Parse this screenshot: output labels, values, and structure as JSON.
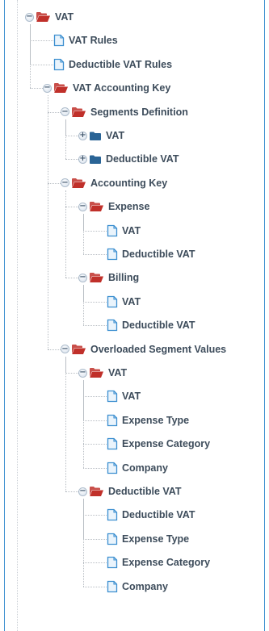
{
  "tree": [
    {
      "label": "VAT",
      "icon": "folder-open-icon",
      "depth": 0,
      "expanded": true,
      "children": [
        {
          "label": "VAT Rules",
          "icon": "document-icon",
          "depth": 1
        },
        {
          "label": "Deductible VAT Rules",
          "icon": "document-icon",
          "depth": 1
        },
        {
          "label": "VAT Accounting Key",
          "icon": "folder-open-icon",
          "depth": 1,
          "expanded": true,
          "children": [
            {
              "label": "Segments Definition",
              "icon": "folder-open-icon",
              "depth": 2,
              "expanded": true,
              "children": [
                {
                  "label": "VAT",
                  "icon": "folder-closed-icon",
                  "depth": 3,
                  "expanded": false
                },
                {
                  "label": "Deductible VAT",
                  "icon": "folder-closed-icon",
                  "depth": 3,
                  "expanded": false
                }
              ]
            },
            {
              "label": "Accounting Key",
              "icon": "folder-open-icon",
              "depth": 2,
              "expanded": true,
              "children": [
                {
                  "label": "Expense",
                  "icon": "folder-open-icon",
                  "depth": 3,
                  "expanded": true,
                  "children": [
                    {
                      "label": "VAT",
                      "icon": "document-icon",
                      "depth": 4
                    },
                    {
                      "label": "Deductible VAT",
                      "icon": "document-icon",
                      "depth": 4
                    }
                  ]
                },
                {
                  "label": "Billing",
                  "icon": "folder-open-icon",
                  "depth": 3,
                  "expanded": true,
                  "children": [
                    {
                      "label": "VAT",
                      "icon": "document-icon",
                      "depth": 4
                    },
                    {
                      "label": "Deductible VAT",
                      "icon": "document-icon",
                      "depth": 4
                    }
                  ]
                }
              ]
            },
            {
              "label": "Overloaded Segment Values",
              "icon": "folder-open-icon",
              "depth": 2,
              "expanded": true,
              "children": [
                {
                  "label": "VAT",
                  "icon": "folder-open-icon",
                  "depth": 3,
                  "expanded": true,
                  "children": [
                    {
                      "label": "VAT",
                      "icon": "document-icon",
                      "depth": 4
                    },
                    {
                      "label": "Expense Type",
                      "icon": "document-icon",
                      "depth": 4
                    },
                    {
                      "label": "Expense Category",
                      "icon": "document-icon",
                      "depth": 4
                    },
                    {
                      "label": "Company",
                      "icon": "document-icon",
                      "depth": 4
                    }
                  ]
                },
                {
                  "label": "Deductible VAT",
                  "icon": "folder-open-icon",
                  "depth": 3,
                  "expanded": true,
                  "children": [
                    {
                      "label": "Deductible VAT",
                      "icon": "document-icon",
                      "depth": 4
                    },
                    {
                      "label": "Expense Type",
                      "icon": "document-icon",
                      "depth": 4
                    },
                    {
                      "label": "Expense Category",
                      "icon": "document-icon",
                      "depth": 4
                    },
                    {
                      "label": "Company",
                      "icon": "document-icon",
                      "depth": 4
                    }
                  ]
                }
              ]
            }
          ]
        }
      ]
    }
  ],
  "colors": {
    "folder_open": "#c0302a",
    "folder_closed": "#2a6496",
    "document": "#3c8fd0",
    "panel_border": "#3c8fd0"
  }
}
